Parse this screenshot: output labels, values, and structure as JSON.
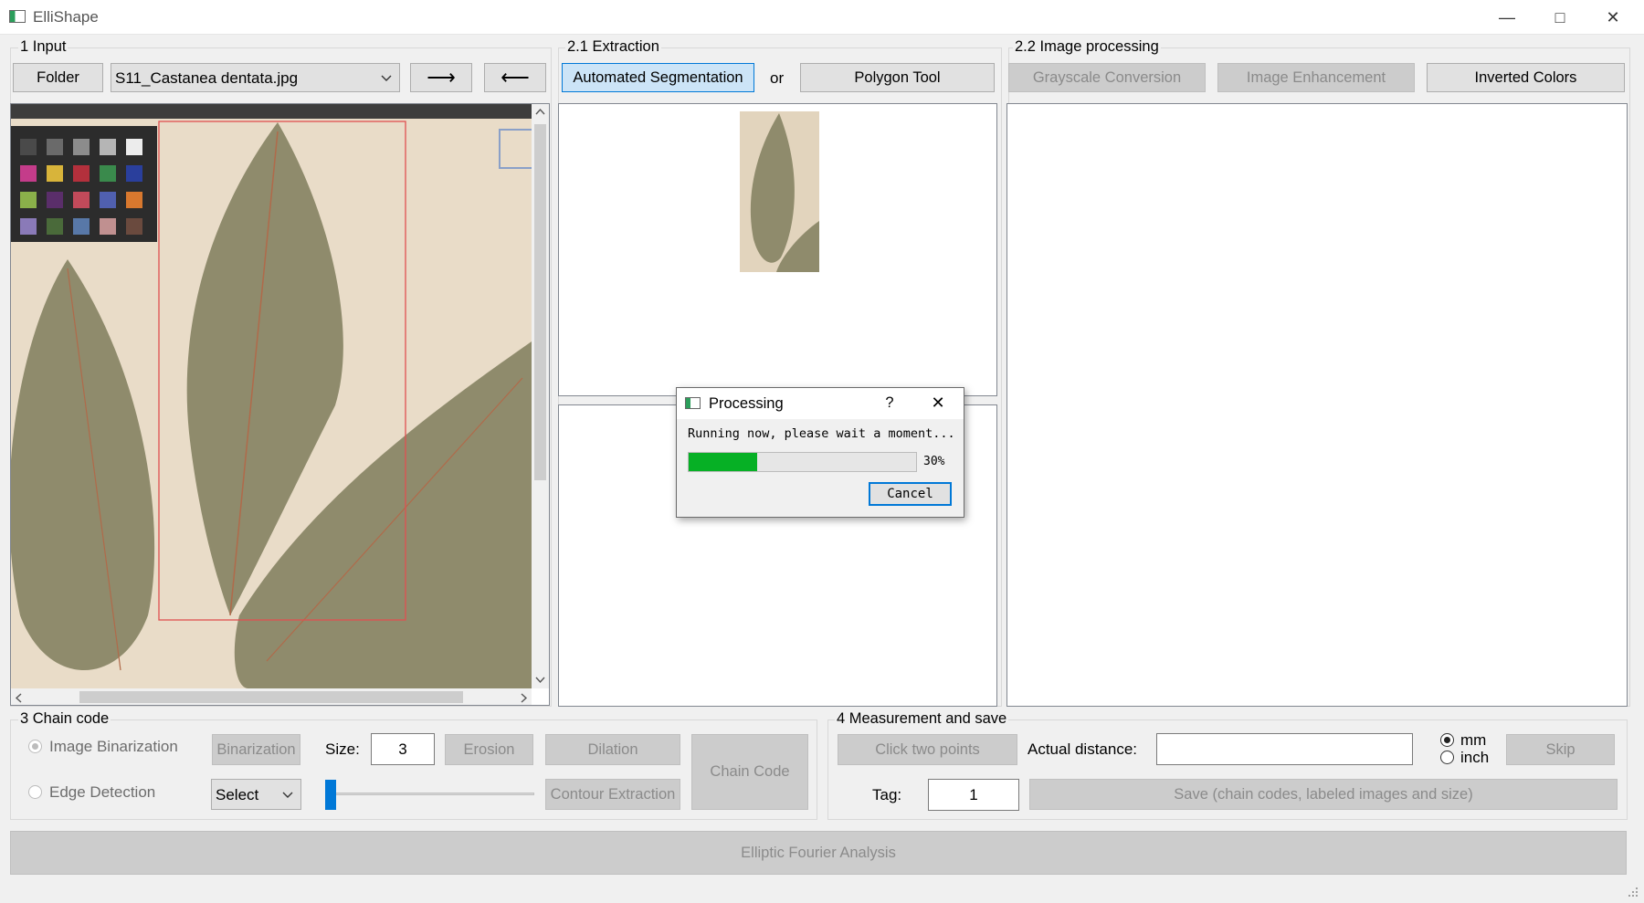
{
  "window": {
    "title": "ElliShape"
  },
  "input_group": {
    "legend": "1 Input",
    "folder_label": "Folder",
    "file_selected": "S11_Castanea dentata.jpg",
    "next_label": "⟶",
    "prev_label": "⟵"
  },
  "extraction_group": {
    "legend": "2.1 Extraction",
    "auto_seg_label": "Automated Segmentation",
    "or_label": "or",
    "polygon_label": "Polygon Tool"
  },
  "processing_group": {
    "legend": "2.2 Image processing",
    "grayscale_label": "Grayscale Conversion",
    "enhance_label": "Image Enhancement",
    "invert_label": "Inverted Colors"
  },
  "chain_group": {
    "legend": "3 Chain code",
    "binarization_radio": "Image Binarization",
    "edge_radio": "Edge Detection",
    "binarization_btn": "Binarization",
    "size_label": "Size:",
    "size_value": "3",
    "erosion_label": "Erosion",
    "dilation_label": "Dilation",
    "chain_code_label": "Chain Code",
    "select_value": "Select",
    "contour_label": "Contour Extraction"
  },
  "measure_group": {
    "legend": "4 Measurement and save",
    "click_points_label": "Click two points",
    "actual_distance_label": "Actual distance:",
    "actual_distance_value": "",
    "unit_mm": "mm",
    "unit_inch": "inch",
    "skip_label": "Skip",
    "tag_label": "Tag:",
    "tag_value": "1",
    "save_label": "Save (chain codes, labeled images and size)"
  },
  "efa_label": "Elliptic Fourier Analysis",
  "dialog": {
    "title": "Processing",
    "help": "?",
    "message": "Running now, please wait a moment...",
    "progress_percent_text": "30%",
    "progress_value": 0.3,
    "cancel_label": "Cancel"
  },
  "colors": {
    "progress_fill": "#06b025",
    "selection_rect": "#e05050",
    "leaf": "#8f8b6c",
    "paper": "#e9dcc8"
  }
}
